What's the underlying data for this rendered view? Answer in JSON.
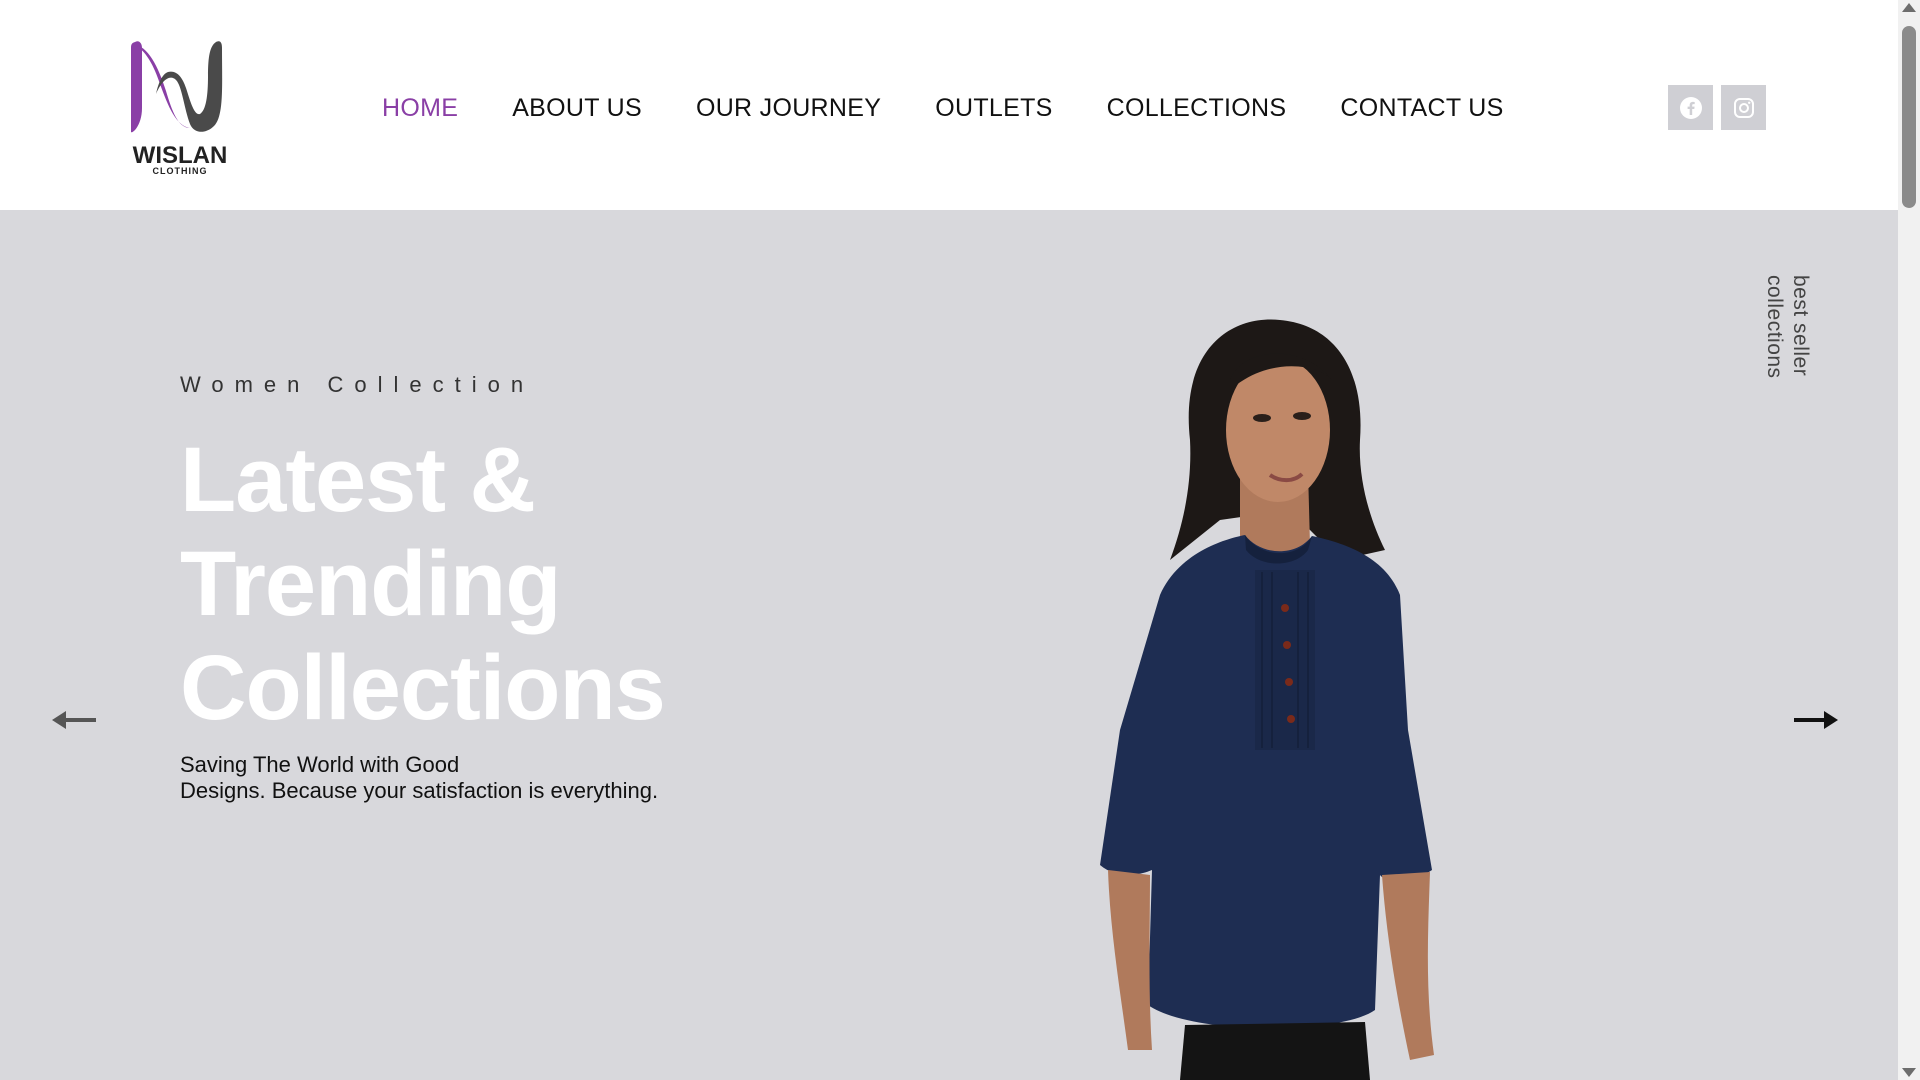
{
  "brand": {
    "name": "WISLAN",
    "subtitle": "CLOTHING",
    "colors": {
      "accent": "#8a3fa6",
      "dark": "#4a4a4a"
    }
  },
  "nav": {
    "items": [
      {
        "label": "HOME",
        "active": true
      },
      {
        "label": "ABOUT US",
        "active": false
      },
      {
        "label": "OUR JOURNEY",
        "active": false
      },
      {
        "label": "OUTLETS",
        "active": false
      },
      {
        "label": "COLLECTIONS",
        "active": false
      },
      {
        "label": "CONTACT US",
        "active": false
      }
    ]
  },
  "social": {
    "icons": [
      "facebook-icon",
      "instagram-icon"
    ]
  },
  "hero": {
    "eyebrow": "Women Collection",
    "headline": [
      "Latest &",
      "Trending",
      "Collections"
    ],
    "tagline": [
      "Saving The World with Good",
      "Designs. Because your satisfaction is everything."
    ],
    "side_label": [
      "best seller",
      "collections"
    ],
    "background": "#d8d8dc",
    "icons": {
      "prev": "arrow-left-icon",
      "next": "arrow-right-icon"
    }
  }
}
